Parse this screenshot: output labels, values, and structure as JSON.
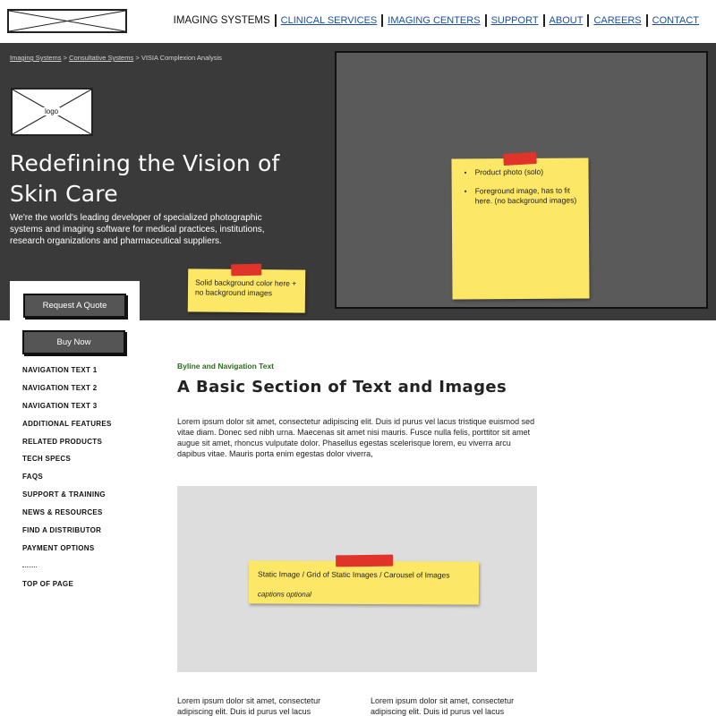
{
  "top_nav": {
    "items": [
      {
        "label": "IMAGING SYSTEMS",
        "active": true
      },
      {
        "label": "CLINICAL SERVICES",
        "active": false
      },
      {
        "label": "IMAGING CENTERS",
        "active": false
      },
      {
        "label": "SUPPORT",
        "active": false
      },
      {
        "label": "ABOUT",
        "active": false
      },
      {
        "label": "CAREERS",
        "active": false
      },
      {
        "label": "CONTACT",
        "active": false
      }
    ]
  },
  "breadcrumb": {
    "items": [
      "Imaging Systems",
      "Consultative Systems"
    ],
    "separator": ">",
    "current": "VISIA Complexion Analysis"
  },
  "hero": {
    "logo_label": "logo",
    "title": "Redefining the Vision of Skin Care",
    "description": "We're the world's leading developer of specialized photographic systems and imaging software for medical practices, institutions, research organizations and pharmaceutical suppliers.",
    "note": "Solid background color here + no background images",
    "quote_button": "Request A Quote",
    "photo_notes": [
      "Product photo (solo)",
      "Foreground image, has to fit here. (no background images)"
    ]
  },
  "sidebar": {
    "buy_button": "Buy Now",
    "items": [
      "NAVIGATION TEXT 1",
      "NAVIGATION TEXT 2",
      "NAVIGATION TEXT 3",
      "ADDITIONAL FEATURES",
      "RELATED PRODUCTS",
      "TECH SPECS",
      "FAQS",
      "SUPPORT & TRAINING",
      "NEWS & RESOURCES",
      "FIND A DISTRIBUTOR",
      "PAYMENT OPTIONS"
    ],
    "top_link": "TOP OF PAGE"
  },
  "content": {
    "byline": "Byline and Navigation Text",
    "title": "A Basic Section of Text and Images",
    "body": "Lorem ipsum dolor sit amet, consectetur adipiscing elit. Duis id purus vel lacus tristique euismod sed vitae diam. Donec sed nibh urna. Maecenas sit amet nisi mauris. Fusce nulla felis, porttitor sit amet augue sit amet, rhoncus vulputate dolor. Phasellus egestas scelerisque lorem, eu viverra arcu dapibus vitae. Mauris porta enim egestas dolor viverra,",
    "image_note": "Static Image / Grid of Static Images / Carousel of Images",
    "image_caption": "captions optional",
    "columns": [
      "Lorem ipsum dolor sit amet, consectetur adipiscing elit. Duis id purus vel lacus",
      "Lorem ipsum dolor sit amet, consectetur adipiscing elit. Duis id purus vel lacus"
    ]
  },
  "colors": {
    "hero_background": "#3a3a3a",
    "link": "#1a4f9c",
    "sticky_note": "#fde766",
    "tape": "#e0332a",
    "byline": "#2e6a1e",
    "image_placeholder": "#dddddd"
  }
}
